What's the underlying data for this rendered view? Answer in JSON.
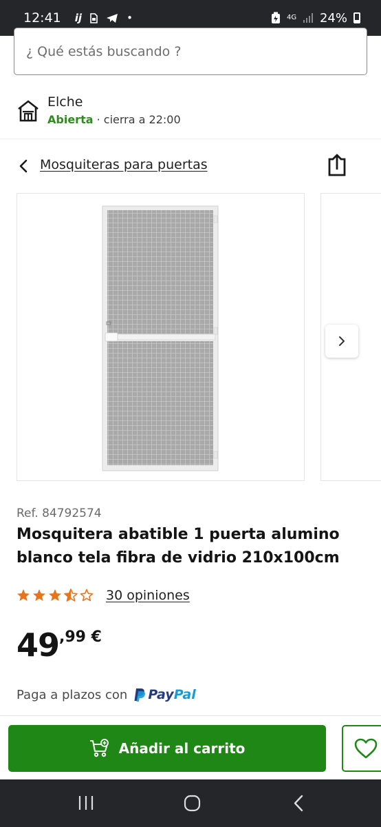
{
  "status_bar": {
    "time": "12:41",
    "left_icons": [
      "ij",
      "sim-card-icon",
      "telegram-icon",
      "•"
    ],
    "network": "4G",
    "battery": "24%"
  },
  "search": {
    "placeholder": "¿ Qué estás buscando ?"
  },
  "store": {
    "name": "Elche",
    "status": "Abierta",
    "hours": " · cierra a 22:00"
  },
  "breadcrumb": {
    "label": "Mosquiteras para puertas"
  },
  "product": {
    "ref": "Ref. 84792574",
    "title": "Mosquitera abatible 1 puerta alumino blanco tela fibra de vidrio 210x100cm",
    "rating": 3.5,
    "rating_max": 5,
    "reviews": "30 opiniones",
    "price_int": "49",
    "price_dec": ",99 €",
    "installments_text": "Paga a plazos con",
    "payment_brand_a": "Pay",
    "payment_brand_b": "Pal"
  },
  "actions": {
    "add_to_cart": "Añadir al carrito"
  },
  "colors": {
    "brand_green": "#1e8716",
    "open_green": "#2e8b1e",
    "star_orange": "#e8741c",
    "paypal_dark": "#253b80",
    "paypal_light": "#179bd7"
  }
}
